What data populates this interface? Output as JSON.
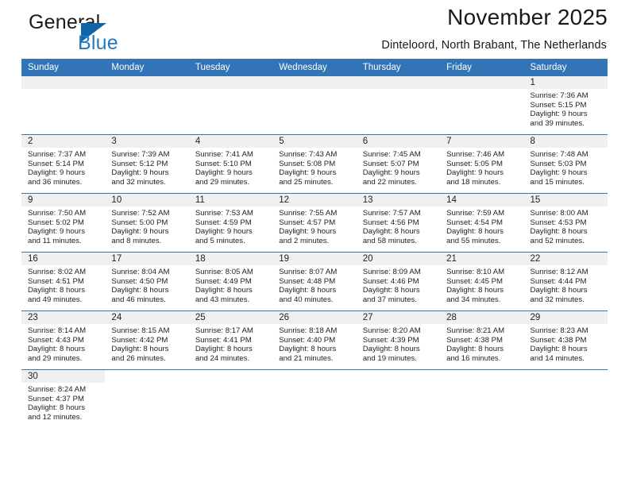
{
  "brand": {
    "word1": "General",
    "word2": "Blue",
    "icon": "triangle-logo"
  },
  "header": {
    "title": "November 2025",
    "subtitle": "Dinteloord, North Brabant, The Netherlands"
  },
  "calendar": {
    "weekday_headers": [
      "Sunday",
      "Monday",
      "Tuesday",
      "Wednesday",
      "Thursday",
      "Friday",
      "Saturday"
    ],
    "colors": {
      "header_bg": "#3274b5",
      "daynum_bg": "#f0f0f0",
      "rule": "#3274b5",
      "accent": "#1f7ac1"
    },
    "weeks": [
      [
        {
          "day": "",
          "lines": []
        },
        {
          "day": "",
          "lines": []
        },
        {
          "day": "",
          "lines": []
        },
        {
          "day": "",
          "lines": []
        },
        {
          "day": "",
          "lines": []
        },
        {
          "day": "",
          "lines": []
        },
        {
          "day": "1",
          "lines": [
            "Sunrise: 7:36 AM",
            "Sunset: 5:15 PM",
            "Daylight: 9 hours",
            "and 39 minutes."
          ]
        }
      ],
      [
        {
          "day": "2",
          "lines": [
            "Sunrise: 7:37 AM",
            "Sunset: 5:14 PM",
            "Daylight: 9 hours",
            "and 36 minutes."
          ]
        },
        {
          "day": "3",
          "lines": [
            "Sunrise: 7:39 AM",
            "Sunset: 5:12 PM",
            "Daylight: 9 hours",
            "and 32 minutes."
          ]
        },
        {
          "day": "4",
          "lines": [
            "Sunrise: 7:41 AM",
            "Sunset: 5:10 PM",
            "Daylight: 9 hours",
            "and 29 minutes."
          ]
        },
        {
          "day": "5",
          "lines": [
            "Sunrise: 7:43 AM",
            "Sunset: 5:08 PM",
            "Daylight: 9 hours",
            "and 25 minutes."
          ]
        },
        {
          "day": "6",
          "lines": [
            "Sunrise: 7:45 AM",
            "Sunset: 5:07 PM",
            "Daylight: 9 hours",
            "and 22 minutes."
          ]
        },
        {
          "day": "7",
          "lines": [
            "Sunrise: 7:46 AM",
            "Sunset: 5:05 PM",
            "Daylight: 9 hours",
            "and 18 minutes."
          ]
        },
        {
          "day": "8",
          "lines": [
            "Sunrise: 7:48 AM",
            "Sunset: 5:03 PM",
            "Daylight: 9 hours",
            "and 15 minutes."
          ]
        }
      ],
      [
        {
          "day": "9",
          "lines": [
            "Sunrise: 7:50 AM",
            "Sunset: 5:02 PM",
            "Daylight: 9 hours",
            "and 11 minutes."
          ]
        },
        {
          "day": "10",
          "lines": [
            "Sunrise: 7:52 AM",
            "Sunset: 5:00 PM",
            "Daylight: 9 hours",
            "and 8 minutes."
          ]
        },
        {
          "day": "11",
          "lines": [
            "Sunrise: 7:53 AM",
            "Sunset: 4:59 PM",
            "Daylight: 9 hours",
            "and 5 minutes."
          ]
        },
        {
          "day": "12",
          "lines": [
            "Sunrise: 7:55 AM",
            "Sunset: 4:57 PM",
            "Daylight: 9 hours",
            "and 2 minutes."
          ]
        },
        {
          "day": "13",
          "lines": [
            "Sunrise: 7:57 AM",
            "Sunset: 4:56 PM",
            "Daylight: 8 hours",
            "and 58 minutes."
          ]
        },
        {
          "day": "14",
          "lines": [
            "Sunrise: 7:59 AM",
            "Sunset: 4:54 PM",
            "Daylight: 8 hours",
            "and 55 minutes."
          ]
        },
        {
          "day": "15",
          "lines": [
            "Sunrise: 8:00 AM",
            "Sunset: 4:53 PM",
            "Daylight: 8 hours",
            "and 52 minutes."
          ]
        }
      ],
      [
        {
          "day": "16",
          "lines": [
            "Sunrise: 8:02 AM",
            "Sunset: 4:51 PM",
            "Daylight: 8 hours",
            "and 49 minutes."
          ]
        },
        {
          "day": "17",
          "lines": [
            "Sunrise: 8:04 AM",
            "Sunset: 4:50 PM",
            "Daylight: 8 hours",
            "and 46 minutes."
          ]
        },
        {
          "day": "18",
          "lines": [
            "Sunrise: 8:05 AM",
            "Sunset: 4:49 PM",
            "Daylight: 8 hours",
            "and 43 minutes."
          ]
        },
        {
          "day": "19",
          "lines": [
            "Sunrise: 8:07 AM",
            "Sunset: 4:48 PM",
            "Daylight: 8 hours",
            "and 40 minutes."
          ]
        },
        {
          "day": "20",
          "lines": [
            "Sunrise: 8:09 AM",
            "Sunset: 4:46 PM",
            "Daylight: 8 hours",
            "and 37 minutes."
          ]
        },
        {
          "day": "21",
          "lines": [
            "Sunrise: 8:10 AM",
            "Sunset: 4:45 PM",
            "Daylight: 8 hours",
            "and 34 minutes."
          ]
        },
        {
          "day": "22",
          "lines": [
            "Sunrise: 8:12 AM",
            "Sunset: 4:44 PM",
            "Daylight: 8 hours",
            "and 32 minutes."
          ]
        }
      ],
      [
        {
          "day": "23",
          "lines": [
            "Sunrise: 8:14 AM",
            "Sunset: 4:43 PM",
            "Daylight: 8 hours",
            "and 29 minutes."
          ]
        },
        {
          "day": "24",
          "lines": [
            "Sunrise: 8:15 AM",
            "Sunset: 4:42 PM",
            "Daylight: 8 hours",
            "and 26 minutes."
          ]
        },
        {
          "day": "25",
          "lines": [
            "Sunrise: 8:17 AM",
            "Sunset: 4:41 PM",
            "Daylight: 8 hours",
            "and 24 minutes."
          ]
        },
        {
          "day": "26",
          "lines": [
            "Sunrise: 8:18 AM",
            "Sunset: 4:40 PM",
            "Daylight: 8 hours",
            "and 21 minutes."
          ]
        },
        {
          "day": "27",
          "lines": [
            "Sunrise: 8:20 AM",
            "Sunset: 4:39 PM",
            "Daylight: 8 hours",
            "and 19 minutes."
          ]
        },
        {
          "day": "28",
          "lines": [
            "Sunrise: 8:21 AM",
            "Sunset: 4:38 PM",
            "Daylight: 8 hours",
            "and 16 minutes."
          ]
        },
        {
          "day": "29",
          "lines": [
            "Sunrise: 8:23 AM",
            "Sunset: 4:38 PM",
            "Daylight: 8 hours",
            "and 14 minutes."
          ]
        }
      ],
      [
        {
          "day": "30",
          "lines": [
            "Sunrise: 8:24 AM",
            "Sunset: 4:37 PM",
            "Daylight: 8 hours",
            "and 12 minutes."
          ]
        },
        {
          "day": "",
          "lines": []
        },
        {
          "day": "",
          "lines": []
        },
        {
          "day": "",
          "lines": []
        },
        {
          "day": "",
          "lines": []
        },
        {
          "day": "",
          "lines": []
        },
        {
          "day": "",
          "lines": []
        }
      ]
    ]
  }
}
